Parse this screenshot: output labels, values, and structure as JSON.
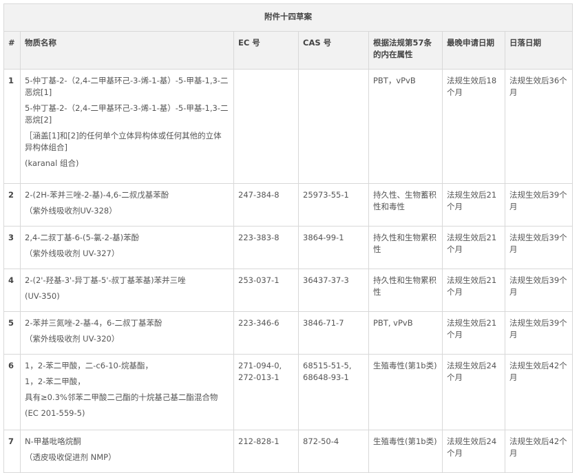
{
  "table": {
    "title": "附件十四草案",
    "headers": [
      "#",
      "物质名称",
      "EC 号",
      "CAS 号",
      "根据法规第57条的内在属性",
      "最晚申请日期",
      "日落日期"
    ],
    "rows": [
      {
        "num": "1",
        "name_lines": [
          "5-仲丁基-2-（2,4-二甲基环己-3-烯-1-基）-5-甲基-1,3-二恶烷[1]",
          "5-仲丁基-2-（2,4-二甲基环己-3-烯-1-基）-5-甲基-1,3-二恶烷[2]",
          "［涵盖[1]和[2]的任何单个立体异构体或任何其他的立体异构体组合]",
          "(karanal 组合)"
        ],
        "ec": "",
        "cas": "",
        "property": "PBT，vPvB",
        "application": "法规生效后18个月",
        "sunset": "法规生效后36个月"
      },
      {
        "num": "2",
        "name_lines": [
          "2-(2H-苯并三唑-2-基)-4,6-二叔戊基苯酚",
          "（紫外线吸收剂UV-328）"
        ],
        "ec": "247-384-8",
        "cas": "25973-55-1",
        "property": "持久性、生物蓄积性和毒性",
        "application": "法规生效后21个月",
        "sunset": "法规生效后39个月"
      },
      {
        "num": "3",
        "name_lines": [
          "2,4-二叔丁基-6-(5-氯-2-基)苯酚",
          "（紫外线吸收剂 UV-327）"
        ],
        "ec": "223-383-8",
        "cas": "3864-99-1",
        "property": "持久性和生物累积性",
        "application": "法规生效后21个月",
        "sunset": "法规生效后39个月"
      },
      {
        "num": "4",
        "name_lines": [
          "2-(2'-羟基-3'-异丁基-5'-叔丁基苯基)苯并三唑",
          "(UV-350)"
        ],
        "ec": "253-037-1",
        "cas": "36437-37-3",
        "property": "持久性和生物累积性",
        "application": "法规生效后21个月",
        "sunset": "法规生效后39个月"
      },
      {
        "num": "5",
        "name_lines": [
          "2-苯并三氮唑-2-基-4，6-二叔丁基苯酚",
          "（紫外线吸收剂 UV-320）"
        ],
        "ec": "223-346-6",
        "cas": "3846-71-7",
        "property": "PBT, vPvB",
        "application": "法规生效后21个月",
        "sunset": "法规生效后39个月"
      },
      {
        "num": "6",
        "name_lines": [
          "1，2-苯二甲酸，二-c6-10-烷基酯，",
          "1，2-苯二甲酸，",
          "具有≥0.3%邻苯二甲酸二己酯的十烷基己基二酯混合物",
          "(EC 201-559-5)"
        ],
        "ec": "271-094-0, 272-013-1",
        "cas": "68515-51-5, 68648-93-1",
        "property": "生殖毒性(第1b类)",
        "application": "法规生效后24个月",
        "sunset": "法规生效后42个月"
      },
      {
        "num": "7",
        "name_lines": [
          "N-甲基吡咯烷酮",
          "（透皮吸收促进剂  NMP）"
        ],
        "ec": "212-828-1",
        "cas": "872-50-4",
        "property": "生殖毒性(第1b类)",
        "application": "法规生效后24个月",
        "sunset": "法规生效后42个月"
      }
    ]
  }
}
